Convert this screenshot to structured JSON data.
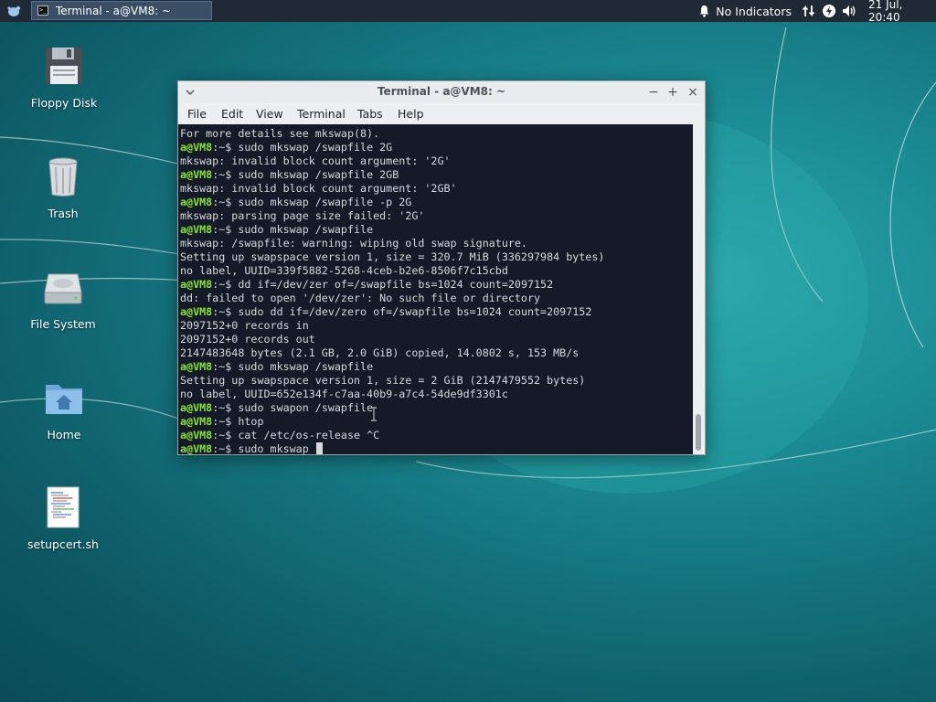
{
  "panel": {
    "taskbar_title": "Terminal - a@VM8: ~",
    "indicators_label": "No Indicators",
    "clock": "21 Jul, 20:40"
  },
  "desktop_icons": [
    {
      "label": "Floppy Disk",
      "icon": "floppy-disk-icon"
    },
    {
      "label": "Trash",
      "icon": "trash-icon"
    },
    {
      "label": "File System",
      "icon": "hard-drive-icon"
    },
    {
      "label": "Home",
      "icon": "home-folder-icon"
    },
    {
      "label": "setupcert.sh",
      "icon": "script-file-icon"
    }
  ],
  "window": {
    "title": "Terminal - a@VM8: ~",
    "menu": [
      "File",
      "Edit",
      "View",
      "Terminal",
      "Tabs",
      "Help"
    ]
  },
  "terminal": {
    "prompt": "a@VM8",
    "lines": [
      {
        "type": "out",
        "text": "For more details see mkswap(8)."
      },
      {
        "type": "cmd",
        "text": "sudo mkswap /swapfile 2G"
      },
      {
        "type": "out",
        "text": "mkswap: invalid block count argument: '2G'"
      },
      {
        "type": "cmd",
        "text": "sudo mkswap /swapfile 2GB"
      },
      {
        "type": "out",
        "text": "mkswap: invalid block count argument: '2GB'"
      },
      {
        "type": "cmd",
        "text": "sudo mkswap /swapfile -p 2G"
      },
      {
        "type": "out",
        "text": "mkswap: parsing page size failed: '2G'"
      },
      {
        "type": "cmd",
        "text": "sudo mkswap /swapfile"
      },
      {
        "type": "out",
        "text": "mkswap: /swapfile: warning: wiping old swap signature."
      },
      {
        "type": "out",
        "text": "Setting up swapspace version 1, size = 320.7 MiB (336297984 bytes)"
      },
      {
        "type": "out",
        "text": "no label, UUID=339f5882-5268-4ceb-b2e6-8506f7c15cbd"
      },
      {
        "type": "cmd",
        "text": "dd if=/dev/zer of=/swapfile bs=1024 count=2097152"
      },
      {
        "type": "out",
        "text": "dd: failed to open '/dev/zer': No such file or directory"
      },
      {
        "type": "cmd",
        "text": "sudo dd if=/dev/zero of=/swapfile bs=1024 count=2097152"
      },
      {
        "type": "out",
        "text": "2097152+0 records in"
      },
      {
        "type": "out",
        "text": "2097152+0 records out"
      },
      {
        "type": "out",
        "text": "2147483648 bytes (2.1 GB, 2.0 GiB) copied, 14.0802 s, 153 MB/s"
      },
      {
        "type": "cmd",
        "text": "sudo mkswap /swapfile"
      },
      {
        "type": "out",
        "text": "Setting up swapspace version 1, size = 2 GiB (2147479552 bytes)"
      },
      {
        "type": "out",
        "text": "no label, UUID=652e134f-c7aa-40b9-a7c4-54de9df3301c"
      },
      {
        "type": "cmd",
        "text": "sudo swapon /swapfile"
      },
      {
        "type": "cmd",
        "text": "htop"
      },
      {
        "type": "cmd",
        "text": "cat /etc/os-release ^C"
      },
      {
        "type": "cmd",
        "text": "sudo mkswap ",
        "current": true
      }
    ]
  }
}
